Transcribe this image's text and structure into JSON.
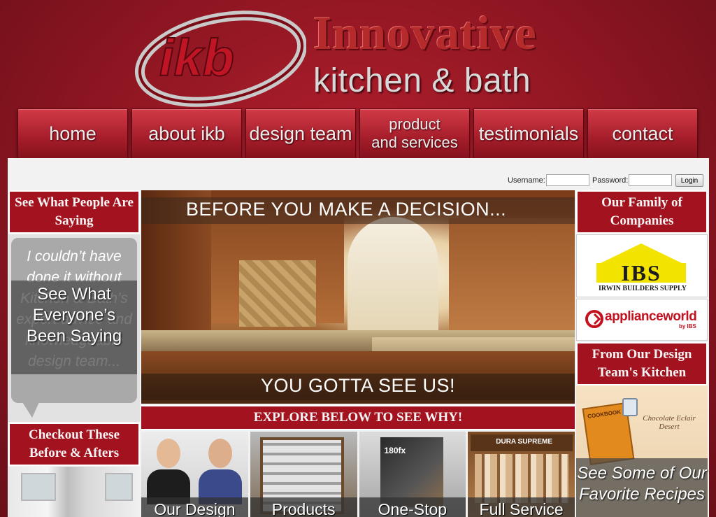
{
  "header": {
    "logo_text": "ikb",
    "brand_name": "Innovative",
    "brand_tagline": "kitchen & bath"
  },
  "nav": {
    "items": [
      {
        "label": "home"
      },
      {
        "label": "about ikb"
      },
      {
        "label": "design team"
      },
      {
        "label": "product\nand services"
      },
      {
        "label": "testimonials"
      },
      {
        "label": "contact"
      }
    ]
  },
  "login": {
    "username_label": "Username:",
    "password_label": "Password:",
    "button_label": "Login",
    "username_value": "",
    "password_value": ""
  },
  "left": {
    "testimonials_heading": "See What People Are Saying",
    "quote": "I couldn’t have done it without Kitchen & Bath’s expert advice and knowledgeable design team...",
    "quote_overlay": "See What Everyone’s Been Saying",
    "before_after_heading": "Checkout These Before & Afters"
  },
  "hero": {
    "caption_top": "BEFORE YOU MAKE A DECISION...",
    "caption_bottom": "YOU GOTTA SEE US!"
  },
  "explore": {
    "heading": "EXPLORE BELOW TO SEE WHY!",
    "tiles": [
      {
        "label": "Our Design"
      },
      {
        "label": "Products"
      },
      {
        "label": "One-Stop"
      },
      {
        "label": "Full Service"
      }
    ],
    "tile_brand_1": "180fx",
    "tile_brand_2": "DURA SUPREME"
  },
  "right": {
    "companies_heading": "Our Family of Companies",
    "ibs_logo": "IBS",
    "ibs_subtitle": "IRWIN BUILDERS SUPPLY",
    "appliance_logo": "applianceworld",
    "appliance_sub": "by IBS",
    "kitchen_heading": "From Our Design Team's Kitchen",
    "cookbook_label": "COOKBOOK",
    "recipe_note": "Chocolate Eclair Desert",
    "recipes_overlay": "See Some of Our Favorite Recipes"
  },
  "colors": {
    "brand_red": "#a3131f",
    "background": "#8e1622",
    "panel": "#f2f2f2"
  }
}
